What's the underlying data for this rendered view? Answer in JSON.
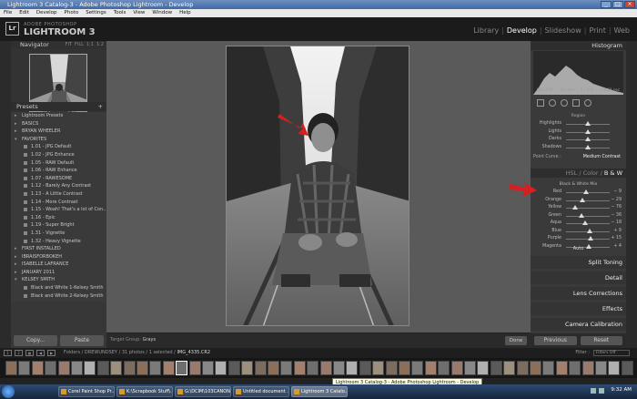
{
  "window": {
    "title": "Lightroom 3 Catalog-3 - Adobe Photoshop Lightroom - Develop",
    "menu": [
      "File",
      "Edit",
      "Develop",
      "Photo",
      "Settings",
      "Tools",
      "View",
      "Window",
      "Help"
    ]
  },
  "header": {
    "logo": "Lr",
    "brand_small": "ADOBE PHOTOSHOP",
    "brand": "LIGHTROOM 3",
    "modules": [
      "Library",
      "Develop",
      "Slideshow",
      "Print",
      "Web"
    ],
    "active_module": "Develop"
  },
  "navigator": {
    "title": "Navigator",
    "zoom_options": [
      "FIT",
      "FILL",
      "1:1",
      "1:2"
    ]
  },
  "presets": {
    "title": "Presets",
    "items": [
      {
        "label": "Lightroom Presets",
        "kind": "folder"
      },
      {
        "label": "BASICS",
        "kind": "folder"
      },
      {
        "label": "BRYAN WHEELER",
        "kind": "folder"
      },
      {
        "label": "FAVORITES",
        "kind": "open"
      },
      {
        "label": "1.01 - JPG Default",
        "kind": "preset"
      },
      {
        "label": "1.02 - JPG Enhance",
        "kind": "preset"
      },
      {
        "label": "1.05 - RAW Default",
        "kind": "preset"
      },
      {
        "label": "1.06 - RAW Enhance",
        "kind": "preset"
      },
      {
        "label": "1.07 - RAWESOME",
        "kind": "preset"
      },
      {
        "label": "1.12 - Barely Any Contrast",
        "kind": "preset"
      },
      {
        "label": "1.13 - A Little Contrast",
        "kind": "preset"
      },
      {
        "label": "1.14 - More Contrast",
        "kind": "preset"
      },
      {
        "label": "1.15 - Woah! That's a lot of Con...",
        "kind": "preset"
      },
      {
        "label": "1.16 - Epic",
        "kind": "preset"
      },
      {
        "label": "1.19 - Super Bright",
        "kind": "preset"
      },
      {
        "label": "1.31 - Vignette",
        "kind": "preset"
      },
      {
        "label": "1.32 - Heavy Vignette",
        "kind": "preset"
      },
      {
        "label": "FIRST INSTALLED",
        "kind": "folder"
      },
      {
        "label": "IBRAISFORBOKEH",
        "kind": "folder"
      },
      {
        "label": "ISABELLE LAFRANCE",
        "kind": "folder"
      },
      {
        "label": "JANUARY 2011",
        "kind": "folder"
      },
      {
        "label": "KELSEY SMITH",
        "kind": "open"
      },
      {
        "label": "Black and White 1-Kelsey Smith",
        "kind": "preset"
      },
      {
        "label": "Black and White 2-Kelsey Smith",
        "kind": "preset"
      }
    ],
    "copy": "Copy...",
    "paste": "Paste"
  },
  "toolbar": {
    "target_group_label": "Target Group:",
    "target_group_value": "Grays",
    "done": "Done"
  },
  "right": {
    "histogram_title": "Histogram",
    "histo_info": [
      "ISO 400",
      "33 mm",
      "f / 2.0",
      "1/640 sec"
    ],
    "region_label": "Region",
    "tone_sliders": [
      {
        "label": "Highlights",
        "pos": 0.5
      },
      {
        "label": "Lights",
        "pos": 0.5
      },
      {
        "label": "Darks",
        "pos": 0.5
      },
      {
        "label": "Shadows",
        "pos": 0.5
      }
    ],
    "point_curve_label": "Point Curve :",
    "point_curve_value": "Medium Contrast",
    "hsl_tabs": [
      "HSL",
      "Color",
      "B & W"
    ],
    "active_tab": "B & W",
    "bw_title": "Black & White Mix",
    "bw_sliders": [
      {
        "label": "Red",
        "value": "− 9",
        "pos": 0.46
      },
      {
        "label": "Orange",
        "value": "− 29",
        "pos": 0.38
      },
      {
        "label": "Yellow",
        "value": "− 76",
        "pos": 0.2
      },
      {
        "label": "Green",
        "value": "− 36",
        "pos": 0.36
      },
      {
        "label": "Aqua",
        "value": "− 18",
        "pos": 0.44
      },
      {
        "label": "Blue",
        "value": "+ 9",
        "pos": 0.55
      },
      {
        "label": "Purple",
        "value": "+ 15",
        "pos": 0.57
      },
      {
        "label": "Magenta",
        "value": "+ 4",
        "pos": 0.52
      }
    ],
    "auto": "Auto",
    "panels": [
      "Split Toning",
      "Detail",
      "Lens Corrections",
      "Effects",
      "Camera Calibration"
    ],
    "previous": "Previous",
    "reset": "Reset"
  },
  "filmbar": {
    "folder_prefix": "Folders / DREWUNDSEY / 31 photos / 1 selected /",
    "filename": "IMG_4335.CR2",
    "filter_label": "Filter :",
    "filter_value": "Filters Off"
  },
  "taskbar": {
    "tasks": [
      "Corel Paint Shop Pr...",
      "K:\\Scrapbook Stuff\\...",
      "G:\\DCIM\\103CANON",
      "Untitled document ...",
      "Lightroom 3 Catalo..."
    ],
    "tooltip": "Lightroom 3 Catalog-3 - Adobe Photoshop Lightroom - Develop",
    "clock": "9:32 AM"
  },
  "colors": {
    "annotation_arrow": "#d42020",
    "panel_bg": "#3a3a3a",
    "center_bg": "#5a5a5a"
  }
}
